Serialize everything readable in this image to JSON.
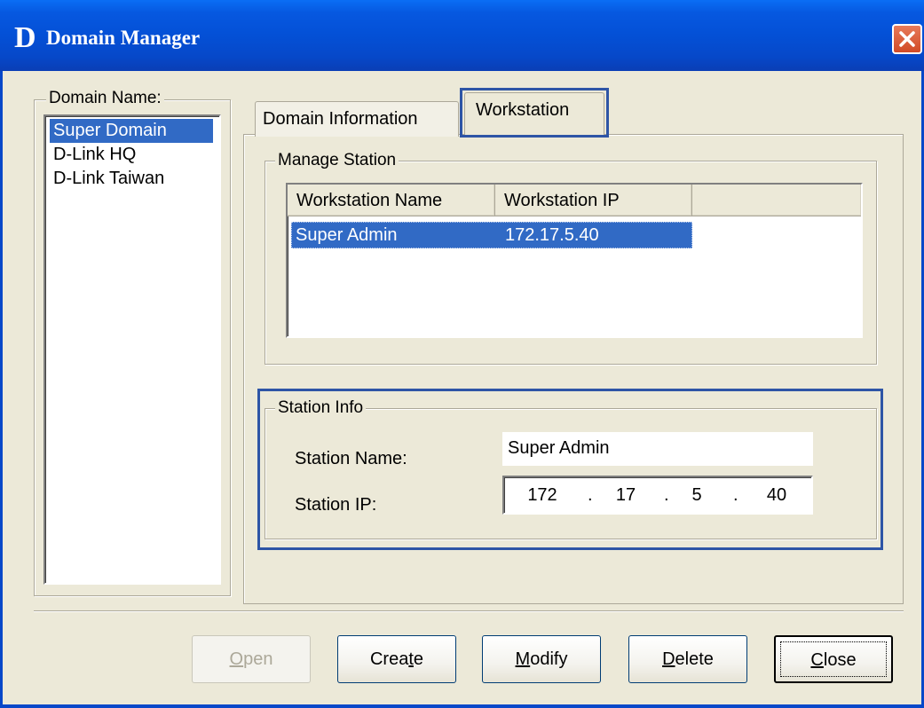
{
  "window": {
    "logo": "D",
    "title": "Domain Manager",
    "close_icon": "close-x-icon"
  },
  "domain_list": {
    "legend": "Domain Name:",
    "items": [
      "Super Domain",
      "D-Link HQ",
      "D-Link Taiwan"
    ],
    "selected_index": 0
  },
  "tabs": [
    {
      "label": "Domain Information",
      "active": false
    },
    {
      "label": "Workstation",
      "active": true
    }
  ],
  "manage_station": {
    "legend": "Manage Station",
    "columns": [
      "Workstation Name",
      "Workstation IP"
    ],
    "rows": [
      {
        "name": "Super Admin",
        "ip": "172.17.5.40",
        "selected": true
      }
    ]
  },
  "station_info": {
    "legend": "Station Info",
    "name_label": "Station Name:",
    "name_value": "Super Admin",
    "ip_label": "Station IP:",
    "ip_octets": [
      "172",
      "17",
      "5",
      "40"
    ],
    "ip_separator": "."
  },
  "buttons": {
    "open": {
      "pre": "",
      "accel": "O",
      "post": "pen",
      "enabled": false
    },
    "create": {
      "pre": "Crea",
      "accel": "t",
      "post": "e",
      "enabled": true
    },
    "modify": {
      "pre": "",
      "accel": "M",
      "post": "odify",
      "enabled": true
    },
    "delete": {
      "pre": "",
      "accel": "D",
      "post": "elete",
      "enabled": true
    },
    "close": {
      "pre": "",
      "accel": "C",
      "post": "lose",
      "enabled": true
    }
  },
  "colors": {
    "title_bar": "#0450d6",
    "selection": "#316ac5",
    "highlight_box": "#2e55a6",
    "window_bg": "#ece9d8"
  }
}
